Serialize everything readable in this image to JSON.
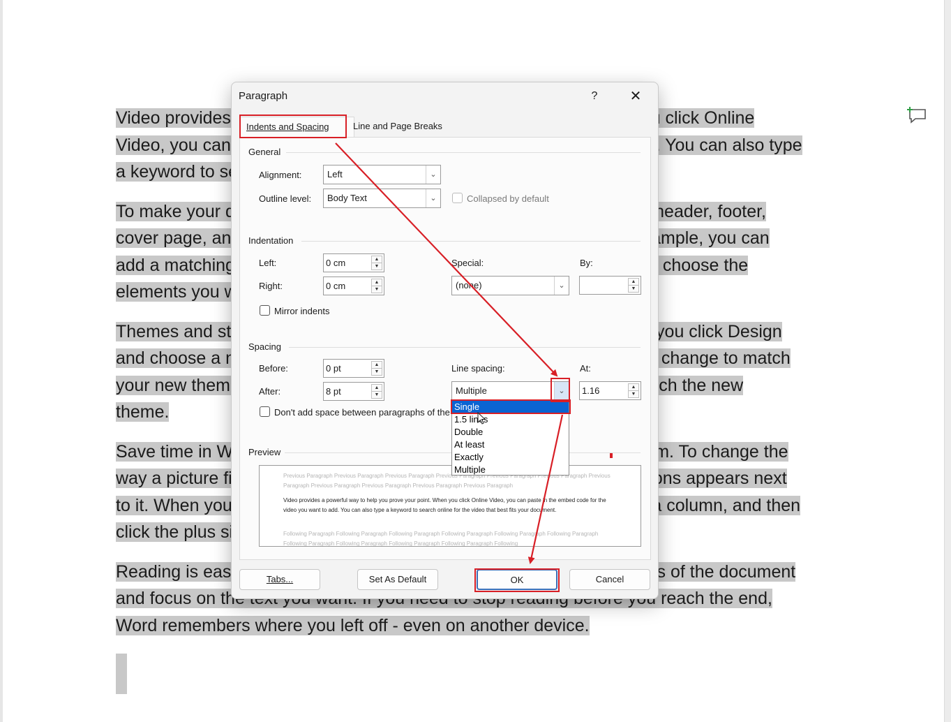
{
  "document": {
    "paragraphs": [
      [
        "Video provides a powerful way to help you prove your point. When you click Online",
        "Video, you can paste in the embed code for the video you want to add. You can also type",
        "a keyword to search online for the video that best fits your document."
      ],
      [
        "To make your document look professionally produced, Word provides header, footer,",
        "cover page, and text box designs that complement each other. For example, you can",
        "add a matching cover page, header, and sidebar. Click Insert and then choose the",
        "elements you want from the different galleries."
      ],
      [
        "Themes and styles also help keep your document coordinated. When you click Design",
        "and choose a new Theme, the pictures, charts, and SmartArt graphics change to match",
        "your new theme. When you apply styles, your headings change to match the new",
        "theme."
      ],
      [
        "Save time in Word with new buttons that show up where you need them. To change the",
        "way a picture fits in your document, click it and a button for layout options appears next",
        "to it. When you work on a table, click where you want to add a row or a column, and then",
        "click the plus sign."
      ],
      [
        "Reading is easier, too, in the new Reading view. You can collapse parts of the document",
        "and focus on the text you want. If you need to stop reading before you reach the end,",
        "Word remembers where you left off - even on another device."
      ]
    ]
  },
  "dialog": {
    "title": "Paragraph",
    "help": "?",
    "close": "✕",
    "tabs": {
      "indents": "Indents and Spacing",
      "breaks": "Line and Page Breaks"
    },
    "general": {
      "heading": "General",
      "alignment_label": "Alignment:",
      "alignment_value": "Left",
      "outline_label": "Outline level:",
      "outline_value": "Body Text",
      "collapsed_label": "Collapsed by default"
    },
    "indentation": {
      "heading": "Indentation",
      "left_label": "Left:",
      "left_value": "0 cm",
      "right_label": "Right:",
      "right_value": "0 cm",
      "special_label": "Special:",
      "special_value": "(none)",
      "by_label": "By:",
      "by_value": "",
      "mirror_label": "Mirror indents"
    },
    "spacing": {
      "heading": "Spacing",
      "before_label": "Before:",
      "before_value": "0 pt",
      "after_label": "After:",
      "after_value": "8 pt",
      "line_spacing_label": "Line spacing:",
      "line_spacing_value": "Multiple",
      "at_label": "At:",
      "at_value": "1.16",
      "dont_add_label": "Don't add space between paragraphs of the same style",
      "line_spacing_options": [
        "Single",
        "1.5 lines",
        "Double",
        "At least",
        "Exactly",
        "Multiple"
      ],
      "highlighted_option": "Single"
    },
    "preview": {
      "heading": "Preview",
      "previous_text": "Previous Paragraph Previous Paragraph Previous Paragraph Previous Paragraph Previous Paragraph Previous Paragraph Previous Paragraph Previous Paragraph Previous Paragraph Previous Paragraph Previous Paragraph",
      "sample_text": "Video provides a powerful way to help you prove your point. When you click Online Video, you can paste in the embed code for the video you want to add. You can also type a keyword to search online for the video that best fits your document.",
      "following_text": "Following Paragraph Following Paragraph Following Paragraph Following Paragraph Following Paragraph Following Paragraph Following Paragraph Following Paragraph Following Paragraph Following Paragraph Following"
    },
    "buttons": {
      "tabs": "Tabs...",
      "set_default": "Set As Default",
      "ok": "OK",
      "cancel": "Cancel"
    }
  },
  "colors": {
    "annotation_red": "#d81f26",
    "selection_gray": "#c8c8c8",
    "list_highlight": "#0a64d2"
  }
}
